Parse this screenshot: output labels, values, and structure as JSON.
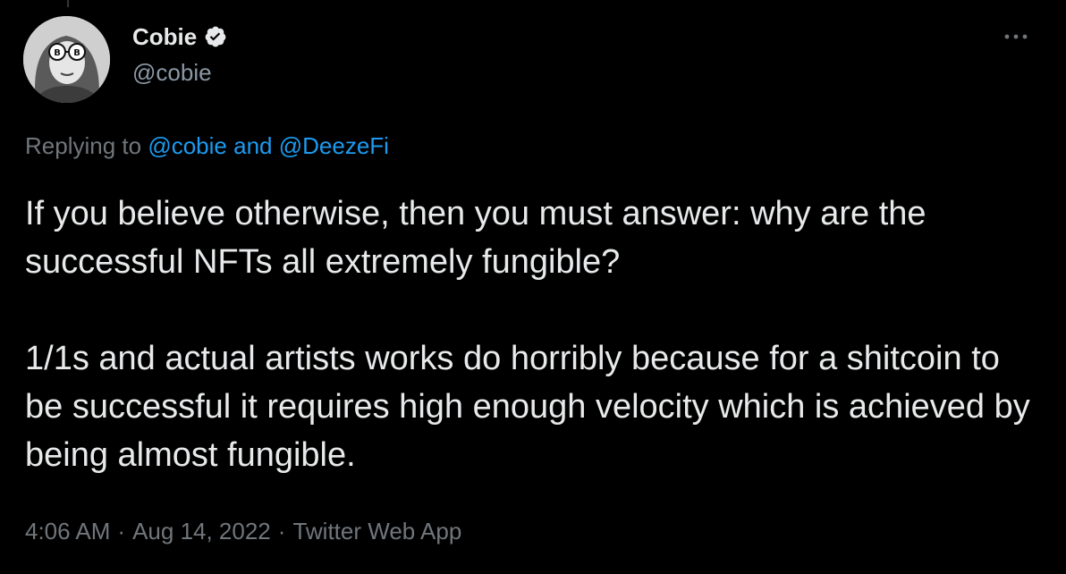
{
  "tweet": {
    "display_name": "Cobie",
    "handle": "@cobie",
    "verified": true,
    "reply_prefix": "Replying to",
    "reply_user_1": "@cobie",
    "reply_conj": "and",
    "reply_user_2": "@DeezeFi",
    "paragraph_1": "If you believe otherwise, then you must answer: why are the successful NFTs all extremely fungible?",
    "paragraph_2": "1/1s and actual artists works do horribly because for a shitcoin to be successful it requires high enough velocity which is achieved by being almost fungible.",
    "time": "4:06 AM",
    "date": "Aug 14, 2022",
    "source": "Twitter Web App",
    "separator": "·",
    "more_label": "···"
  },
  "icons": {
    "avatar": "avatar-photo",
    "verified": "verified-badge-icon",
    "more": "more-dots-icon"
  },
  "colors": {
    "background": "#000000",
    "text": "#e7e9ea",
    "secondary": "#71767b",
    "link": "#1d9bf0"
  }
}
